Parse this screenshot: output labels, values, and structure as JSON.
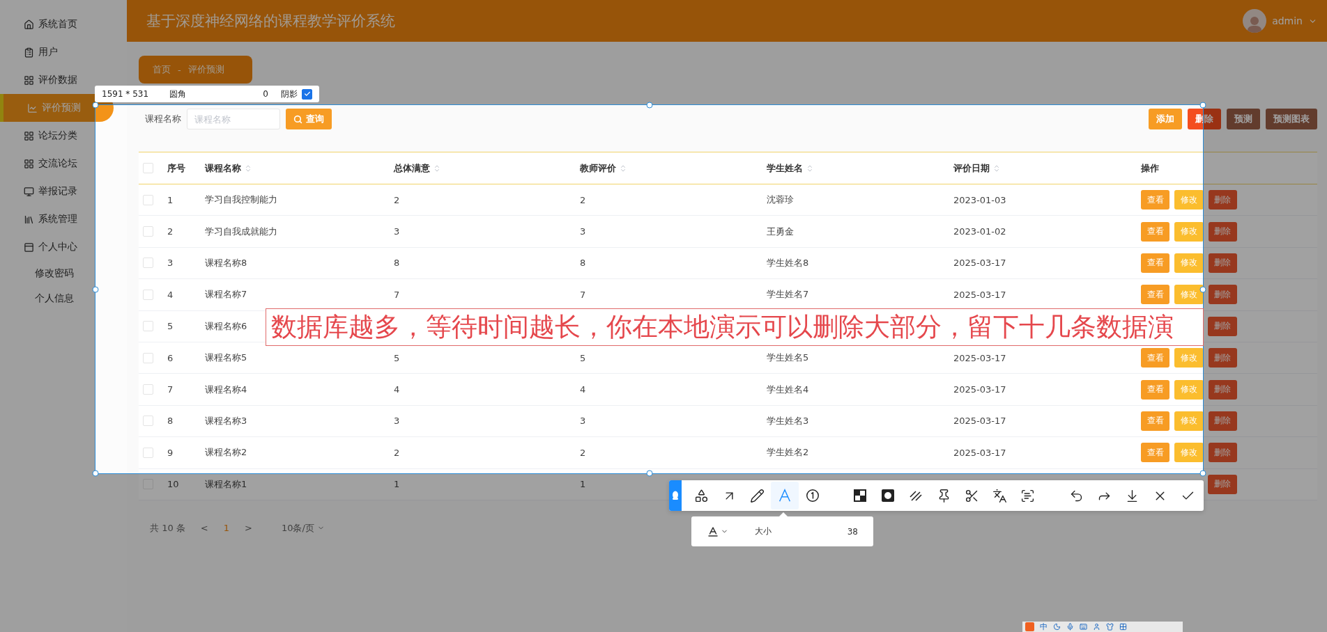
{
  "sidebar": {
    "items": [
      {
        "label": "系统首页",
        "selected": false
      },
      {
        "label": "用户",
        "selected": false
      },
      {
        "label": "评价数据",
        "selected": false
      },
      {
        "label": "评价预测",
        "selected": true
      },
      {
        "label": "论坛分类",
        "selected": false
      },
      {
        "label": "交流论坛",
        "selected": false
      },
      {
        "label": "举报记录",
        "selected": false
      },
      {
        "label": "系统管理",
        "selected": false
      },
      {
        "label": "个人中心",
        "selected": false,
        "children": [
          {
            "label": "修改密码",
            "selected": false
          },
          {
            "label": "个人信息",
            "selected": false
          }
        ]
      }
    ]
  },
  "header": {
    "title": "基于深度神经网络的课程教学评价系统",
    "user": "admin"
  },
  "breadcrumb": {
    "items": [
      "首页",
      "评价预测"
    ],
    "separator": "-"
  },
  "search": {
    "label": "课程名称",
    "placeholder": "课程名称",
    "button": "查询"
  },
  "actions": [
    {
      "label": "添加",
      "kind": "primary"
    },
    {
      "label": "删除",
      "kind": "danger"
    },
    {
      "label": "预测",
      "kind": "dark"
    },
    {
      "label": "预测图表",
      "kind": "dark"
    }
  ],
  "table": {
    "select_all": {
      "checked": false
    },
    "columns": [
      {
        "label": "序号",
        "sortable": false
      },
      {
        "label": "课程名称",
        "sortable": true
      },
      {
        "label": "总体满意",
        "sortable": true
      },
      {
        "label": "教师评价",
        "sortable": true
      },
      {
        "label": "学生姓名",
        "sortable": true
      },
      {
        "label": "评价日期",
        "sortable": true
      },
      {
        "label": "操作",
        "sortable": false
      }
    ],
    "rows": [
      {
        "checked": false,
        "cells": [
          "1",
          "学习自我控制能力",
          "2",
          "2",
          "沈蓉珍",
          "2023-01-03"
        ],
        "buttons": [
          {
            "label": "查看",
            "kind": "view"
          },
          {
            "label": "修改",
            "kind": "edit"
          },
          {
            "label": "删除",
            "kind": "delete"
          }
        ]
      },
      {
        "checked": false,
        "cells": [
          "2",
          "学习自我成就能力",
          "3",
          "3",
          "王勇金",
          "2023-01-02"
        ],
        "buttons": [
          {
            "label": "查看",
            "kind": "view"
          },
          {
            "label": "修改",
            "kind": "edit"
          },
          {
            "label": "删除",
            "kind": "delete"
          }
        ]
      },
      {
        "checked": false,
        "cells": [
          "3",
          "课程名称8",
          "8",
          "8",
          "学生姓名8",
          "2025-03-17"
        ],
        "buttons": [
          {
            "label": "查看",
            "kind": "view"
          },
          {
            "label": "修改",
            "kind": "edit"
          },
          {
            "label": "删除",
            "kind": "delete"
          }
        ]
      },
      {
        "checked": false,
        "cells": [
          "4",
          "课程名称7",
          "7",
          "7",
          "学生姓名7",
          "2025-03-17"
        ],
        "buttons": [
          {
            "label": "查看",
            "kind": "view"
          },
          {
            "label": "修改",
            "kind": "edit"
          },
          {
            "label": "删除",
            "kind": "delete"
          }
        ]
      },
      {
        "checked": false,
        "cells": [
          "5",
          "课程名称6"
        ],
        "buttons": [
          {
            "label": "删除",
            "kind": "delete"
          }
        ]
      },
      {
        "checked": false,
        "cells": [
          "6",
          "课程名称5",
          "5",
          "5",
          "学生姓名5",
          "2025-03-17"
        ],
        "buttons": [
          {
            "label": "查看",
            "kind": "view"
          },
          {
            "label": "修改",
            "kind": "edit"
          },
          {
            "label": "删除",
            "kind": "delete"
          }
        ]
      },
      {
        "checked": false,
        "cells": [
          "7",
          "课程名称4",
          "4",
          "4",
          "学生姓名4",
          "2025-03-17"
        ],
        "buttons": [
          {
            "label": "查看",
            "kind": "view"
          },
          {
            "label": "修改",
            "kind": "edit"
          },
          {
            "label": "删除",
            "kind": "delete"
          }
        ]
      },
      {
        "checked": false,
        "cells": [
          "8",
          "课程名称3",
          "3",
          "3",
          "学生姓名3",
          "2025-03-17"
        ],
        "buttons": [
          {
            "label": "查看",
            "kind": "view"
          },
          {
            "label": "修改",
            "kind": "edit"
          },
          {
            "label": "删除",
            "kind": "delete"
          }
        ]
      },
      {
        "checked": false,
        "cells": [
          "9",
          "课程名称2",
          "2",
          "2",
          "学生姓名2",
          "2025-03-17"
        ],
        "buttons": [
          {
            "label": "查看",
            "kind": "view"
          },
          {
            "label": "修改",
            "kind": "edit"
          },
          {
            "label": "删除",
            "kind": "delete"
          }
        ]
      },
      {
        "checked": false,
        "cells": [
          "10",
          "课程名称1",
          "1",
          "1"
        ],
        "buttons": [
          {
            "label": "删除",
            "kind": "delete"
          }
        ]
      }
    ]
  },
  "pagination": {
    "total": "共 10 条",
    "prev": "<",
    "page": "1",
    "next": ">",
    "page_size": "10条/页"
  },
  "capture": {
    "size": "1591 * 531",
    "radius_label": "圆角",
    "radius": "0",
    "shadow_label": "阴影",
    "shadow": true
  },
  "annotation": {
    "text": "数据库越多，等待时间越长，你在本地演示可以删除大部分，留下十几条数据演"
  },
  "toolbar": {
    "groups": [
      [
        {
          "selected": false
        },
        {
          "selected": false
        },
        {
          "selected": false
        },
        {
          "selected": true
        },
        {
          "selected": false
        }
      ],
      [
        {
          "selected": false
        },
        {
          "selected": false
        },
        {
          "selected": false
        },
        {
          "selected": false
        },
        {
          "selected": false
        },
        {
          "selected": false
        },
        {
          "selected": false
        }
      ],
      [
        {
          "selected": false
        },
        {
          "selected": false
        },
        {
          "selected": false
        },
        {
          "selected": false
        },
        {
          "selected": false
        }
      ]
    ]
  },
  "text_panel": {
    "size_label": "大小",
    "size": "38"
  },
  "ime_bar": {
    "text": "中"
  }
}
